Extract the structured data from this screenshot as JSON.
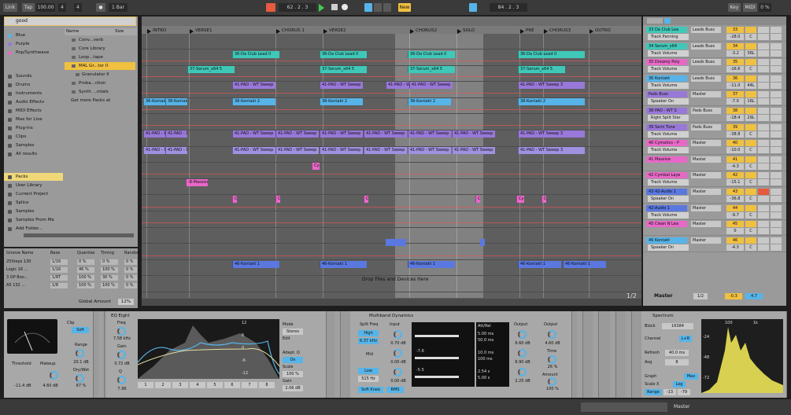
{
  "top": {
    "link": "Link",
    "tap": "Tap",
    "tempo": "100.00",
    "sig_num": "4",
    "sig_den": "4",
    "metro": "1 Bar",
    "pos": "62 . 2 . 3",
    "new": "New",
    "loop_start": "84 . 2 . 3",
    "key": "Key",
    "midi": "MIDI",
    "cpu": "0 %"
  },
  "browser": {
    "search": "good",
    "colors": [
      "Blue",
      "Purple",
      "Pop/Synthwave"
    ],
    "categories": [
      "Sounds",
      "Drums",
      "Instruments",
      "Audio Effects",
      "MIDI Effects",
      "Max for Live",
      "Plug-Ins",
      "Clips",
      "Samples",
      "All results"
    ],
    "places": [
      "Packs",
      "User Library",
      "Current Project",
      "Splice",
      "Samples",
      "Samples From Ma",
      "Add Folder..."
    ],
    "header_name": "Name",
    "header_size": "Size",
    "files": [
      "Conv...verb",
      "Core Library",
      "Loop...tape",
      "M4L Gr...tor II",
      "Granulator II",
      "Proba...ction",
      "Synth ...ntials",
      "Get more Packs at"
    ]
  },
  "groove": {
    "headers": [
      "Groove Name",
      "Base",
      "Quantize",
      "Timing",
      "Random"
    ],
    "rows": [
      [
        "25Steps 130",
        "1/16",
        "0 %",
        "0 %",
        "0 %"
      ],
      [
        "Logic 16 ...",
        "1/16",
        "46 %",
        "100 %",
        "0 %"
      ],
      [
        "3 OP Boo...",
        "1/8T",
        "100 %",
        "30 %",
        "0 %"
      ],
      [
        "A5 132 ...",
        "1/8",
        "100 %",
        "100 %",
        "0 %"
      ]
    ],
    "global_label": "Global Amount",
    "global_value": "12%"
  },
  "arrangement": {
    "locators": [
      "INTRO",
      "VERSE1",
      "CHORUS 1",
      "VERSE2",
      "CHORUS2",
      "SOLO",
      "PRE",
      "CHORUS3",
      "OUTRO"
    ],
    "drop_text": "Drop Files and Devices Here",
    "page": "1/2",
    "clips": {
      "club": "36-Da Club Lead II",
      "serum": "37-Serum_x64 5",
      "pad": "41-PAD - WT Sweep",
      "kontakt2": "38-Kontakt 2",
      "kontakt": "36-Kontakt",
      "pad3": "41-PAD - WT Sweep 3",
      "pad1": "41-PAD - 1",
      "massive": "-8-Massive",
      "cym": "Cym",
      "kontakt1": "46-Kontakt 1"
    }
  },
  "mixer": {
    "tracks": [
      {
        "name": "33 Da Club Lea",
        "sel": "Track Panning",
        "route": "Leads Buss",
        "num": "33",
        "vol": "-28.0",
        "pan": "C",
        "color": "#3fc8b8"
      },
      {
        "name": "34 Serum_x64",
        "sel": "Track Volume",
        "route": "Leads Buss",
        "num": "34",
        "vol": "-3.2",
        "pan": "36L",
        "color": "#3fc8b8"
      },
      {
        "name": "35 Dreamy Poly",
        "sel": "Track Volume",
        "route": "Leads Buss",
        "num": "35",
        "vol": "-16.6",
        "pan": "C",
        "color": "#e868c8"
      },
      {
        "name": "36 Kontakt",
        "sel": "Track Volume",
        "route": "Leads Buss",
        "num": "36",
        "vol": "-11.0",
        "pan": "44L",
        "color": "#56b4e8"
      },
      {
        "name": "Pads Buss",
        "sel": "Speaker On",
        "route": "Master",
        "num": "37",
        "vol": "-7.0",
        "pan": "16L",
        "color": "#9878d8"
      },
      {
        "name": "38 PAD - WT S",
        "sel": "Right Split Ster",
        "route": "Pads Buss",
        "num": "38",
        "vol": "-18.4",
        "pan": "29L",
        "color": "#9878d8"
      },
      {
        "name": "39 Semi Tune",
        "sel": "Track Volume",
        "route": "Pads Buss",
        "num": "39",
        "vol": "-38.8",
        "pan": "C",
        "color": "#9878d8"
      },
      {
        "name": "40 Cymatics - P",
        "sel": "Track Volume",
        "route": "Master",
        "num": "40",
        "vol": "-10.0",
        "pan": "C",
        "color": "#e868c8"
      },
      {
        "name": "41 Massive",
        "sel": "",
        "route": "Master",
        "num": "41",
        "vol": "-4.3",
        "pan": "C",
        "color": "#e868c8"
      },
      {
        "name": "42 Cymbal Laye",
        "sel": "Track Volume",
        "route": "Master",
        "num": "42",
        "vol": "-15.1",
        "pan": "C",
        "color": "#e868c8"
      },
      {
        "name": "43 42-Audio 1",
        "sel": "Speaker On",
        "route": "Master",
        "num": "43",
        "vol": "-36.8",
        "pan": "C",
        "color": "#5a78e0"
      },
      {
        "name": "42-Audio 1",
        "sel": "Track Volume",
        "route": "Master",
        "num": "44",
        "vol": "-9.7",
        "pan": "C",
        "color": "#5a78e0"
      },
      {
        "name": "45 Clean N Lea",
        "sel": "",
        "route": "Master",
        "num": "45",
        "vol": "0",
        "pan": "C",
        "color": "#e868c8"
      },
      {
        "name": "46 Kontakt",
        "sel": "Speaker On",
        "route": "Master",
        "num": "46",
        "vol": "-4.3",
        "pan": "C",
        "color": "#56b4e8"
      }
    ],
    "master": "Master",
    "master_page": "1/2",
    "master_vol": "-0.3",
    "master_pan": "4.7"
  },
  "devices": {
    "comp": {
      "clip": "Clip",
      "soft": "Soft",
      "range_label": "Range",
      "range": "20.1 dB",
      "drywet_label": "Dry/Wet",
      "drywet": "67 %",
      "threshold_label": "Threshold",
      "threshold": "-11.4 dB",
      "makeup_label": "Makeup",
      "makeup": "4.60 dB"
    },
    "eq": {
      "title": "EQ Eight",
      "freq_label": "Freq",
      "freq": "7.58 kHz",
      "gain_label": "Gain",
      "gain": "0.72 dB",
      "q_label": "Q",
      "q": "7.96",
      "mode_label": "Mode",
      "mode": "Stereo",
      "edit_label": "Edit",
      "adapt_label": "Adapt. Q",
      "adapt": "On",
      "scale_label": "Scale",
      "scale": "100 %",
      "out_gain_label": "Gain",
      "out_gain": "2.06 dB",
      "bands": [
        "1",
        "2",
        "3",
        "4",
        "5",
        "6",
        "7",
        "8"
      ],
      "db": [
        "12",
        "6",
        "0",
        "-6",
        "-12"
      ],
      "side": "EQ Eight"
    },
    "mbd": {
      "title": "Multiband Dynamics",
      "split_label": "Split Freq",
      "input_label": "Input",
      "high": "High",
      "high_freq": "6.37 kHz",
      "high_in": "0.70 dB",
      "mid": "Mid",
      "mid_in": "0.00 dB",
      "low": "Low",
      "low_freq": "515 Hz",
      "low_in": "0.00 dB",
      "soft_knee": "Soft Knee",
      "rms": "RMS",
      "att_rel": "Att/Rel",
      "att1": "5.00 ms",
      "rel1": "50.0 ms",
      "att2": "10.0 ms",
      "rel2": "100 ms",
      "att3": "2.54 s",
      "rel3": "5.00 s",
      "out_label": "Output",
      "out1": "6.60 dB",
      "out2": "6.90 dB",
      "out3": "2.25 dB",
      "m1": "-7.6",
      "m2": "-5.5",
      "output2_label": "Output",
      "output2": "4.60 dB",
      "time_label": "Time",
      "time": "26 %",
      "amount_label": "Amount",
      "amount": "100 %"
    },
    "spec": {
      "title": "Spectrum",
      "block_label": "Block",
      "block": "16384",
      "channel_label": "Channel",
      "channel": "L+R",
      "refresh_label": "Refresh",
      "refresh": "40.0 ms",
      "avg_label": "Avg",
      "avg": "8",
      "graph_label": "Graph",
      "max": "Max",
      "scale_x_label": "Scale X",
      "scale_x": "Log",
      "range_label": "Range",
      "range_lo": "-13",
      "range_hi": "-79",
      "f1": "100",
      "f2": "1k",
      "db_top": "-24",
      "db_mid": "-48",
      "db_bot": "-72"
    },
    "side_labels": [
      "Compressor",
      "Abletunes",
      "Abletunes",
      "Abletunes",
      "Groove 8",
      "Abletunes",
      "Abletunes"
    ]
  },
  "bottom": {
    "master": "Master"
  }
}
